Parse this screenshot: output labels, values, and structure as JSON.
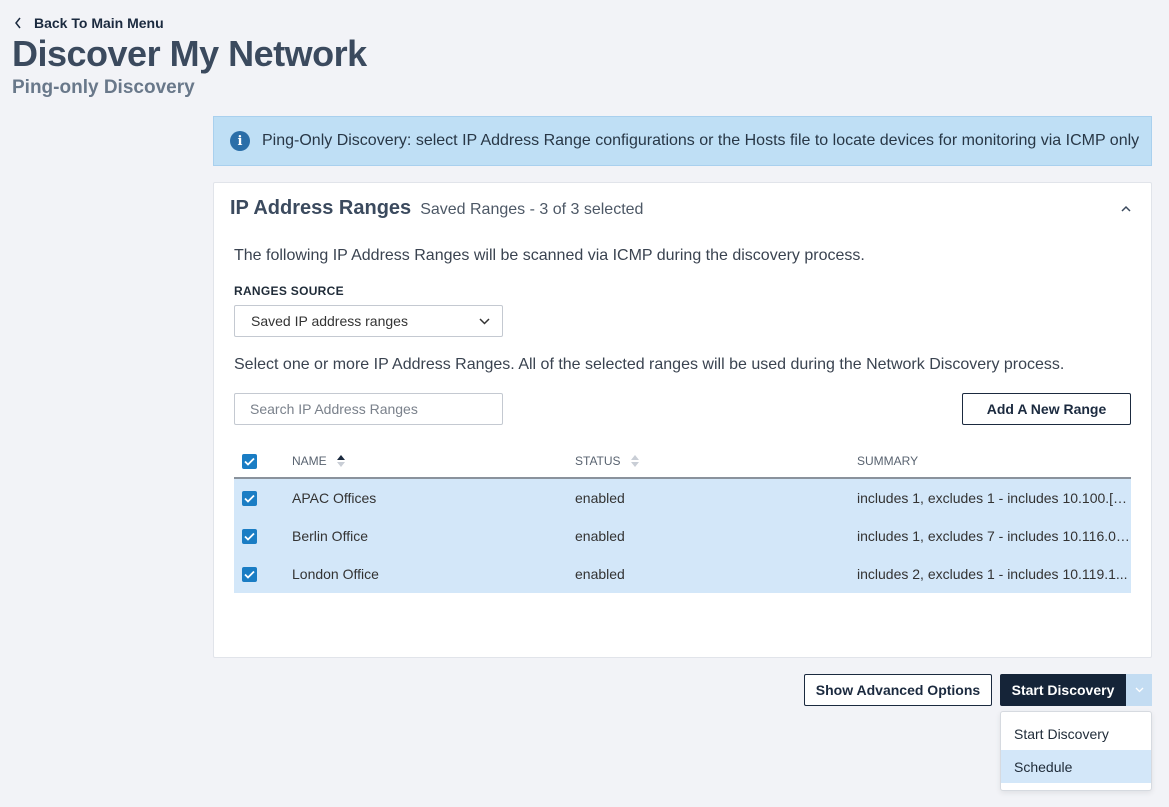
{
  "nav": {
    "back_label": "Back To Main Menu"
  },
  "page": {
    "title": "Discover My Network",
    "subtitle": "Ping-only Discovery"
  },
  "banner": {
    "text": "Ping-Only Discovery: select IP Address Range configurations or the Hosts file to locate devices for monitoring via ICMP only",
    "icon": "info-icon",
    "icon_glyph": "i"
  },
  "card": {
    "title": "IP Address Ranges",
    "subtitle": "Saved Ranges - 3 of 3 selected",
    "description": "The following IP Address Ranges will be scanned via ICMP during the discovery process.",
    "ranges_source_label": "RANGES SOURCE",
    "ranges_source_value": "Saved IP address ranges",
    "select_instructions": "Select one or more IP Address Ranges. All of the selected ranges will be used during the Network Discovery process.",
    "search_placeholder": "Search IP Address Ranges",
    "add_range_label": "Add A New Range"
  },
  "table": {
    "columns": {
      "name": "NAME",
      "status": "STATUS",
      "summary": "SUMMARY"
    },
    "sort": {
      "column": "name",
      "direction": "ascending"
    },
    "select_all_checked": true,
    "rows": [
      {
        "checked": true,
        "name": "APAC Offices",
        "status": "enabled",
        "summary": "includes 1, excludes 1 - includes 10.100.[6..."
      },
      {
        "checked": true,
        "name": "Berlin Office",
        "status": "enabled",
        "summary": "includes 1, excludes 7 - includes 10.116.0...."
      },
      {
        "checked": true,
        "name": "London Office",
        "status": "enabled",
        "summary": "includes 2, excludes 1 - includes 10.119.1..."
      }
    ]
  },
  "actions": {
    "advanced_label": "Show Advanced Options",
    "start_label": "Start Discovery",
    "menu": [
      {
        "label": "Start Discovery",
        "active": false
      },
      {
        "label": "Schedule",
        "active": true
      }
    ]
  },
  "colors": {
    "accent": "#1a7dc4",
    "primary_button": "#152438",
    "selected_row": "#d3e7f9",
    "banner_bg": "#bfdff5"
  }
}
